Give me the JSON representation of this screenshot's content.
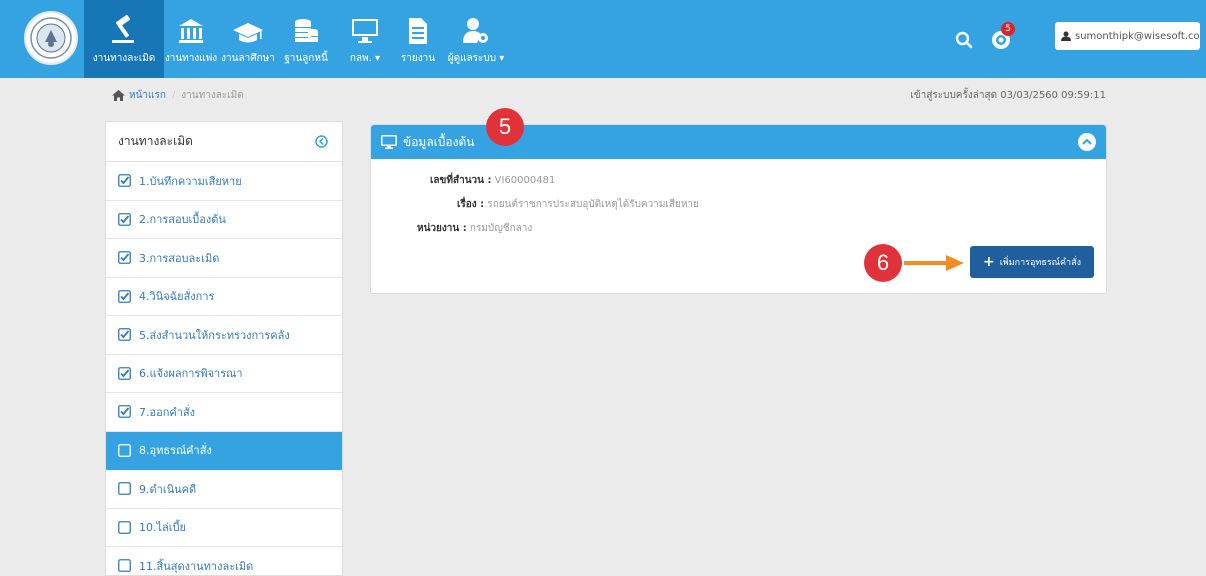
{
  "topnav": {
    "items": [
      {
        "label": "งานทางละเมิด",
        "icon": "gavel-icon",
        "active": true
      },
      {
        "label": "งานทางแพ่ง",
        "icon": "bank-icon",
        "active": false
      },
      {
        "label": "งานลาศึกษา",
        "icon": "graduation-cap-icon",
        "active": false
      },
      {
        "label": "ฐานลูกหนี้",
        "icon": "coins-icon",
        "active": false
      },
      {
        "label": "กลพ. ▾",
        "icon": "monitor-icon",
        "active": false
      },
      {
        "label": "รายงาน",
        "icon": "document-icon",
        "active": false
      },
      {
        "label": "ผู้ดูแลระบบ ▾",
        "icon": "user-gear-icon",
        "active": false
      }
    ],
    "notification_count": "5",
    "user_email": "sumonthipk@wisesoft.co.th"
  },
  "breadcrumb": {
    "home": "หน้าแรก",
    "separator": "/",
    "current": "งานทางละเมิด"
  },
  "last_login": "เข้าสู่ระบบครั้งล่าสุด 03/03/2560 09:59:11",
  "sidebar": {
    "title": "งานทางละเมิด",
    "items": [
      {
        "label": "1.บันทึกความเสียหาย",
        "checked": true
      },
      {
        "label": "2.การสอบเบื้องต้น",
        "checked": true
      },
      {
        "label": "3.การสอบละเมิด",
        "checked": true
      },
      {
        "label": "4.วินิจฉัยสั่งการ",
        "checked": true
      },
      {
        "label": "5.ส่งสำนวนให้กระทรวงการคลัง",
        "checked": true
      },
      {
        "label": "6.แจ้งผลการพิจารณา",
        "checked": true
      },
      {
        "label": "7.ออกคำสั่ง",
        "checked": true
      },
      {
        "label": "8.อุทธรณ์คำสั่ง",
        "checked": false,
        "active": true
      },
      {
        "label": "9.ดำเนินคดี",
        "checked": false
      },
      {
        "label": "10.ไล่เบี้ย",
        "checked": false
      },
      {
        "label": "11.สิ้นสุดงานทางละเมิด",
        "checked": false
      }
    ]
  },
  "panel": {
    "title": "ข้อมูลเบื้องต้น",
    "fields": {
      "case_no_label": "เลขที่สำนวน :",
      "case_no_value": "VI60000481",
      "subject_label": "เรื่อง :",
      "subject_value": "รถยนต์ราชการประสบอุบัติเหตุได้รับความเสียหาย",
      "agency_label": "หน่วยงาน :",
      "agency_value": "กรมบัญชีกลาง"
    },
    "add_button": "เพิ่มการอุทธรณ์คำสั่ง"
  },
  "annotations": {
    "marker_5": "5",
    "marker_6": "6"
  },
  "colors": {
    "nav_bg": "#35a3e2",
    "nav_active": "#1676b6",
    "button": "#1f5f9e",
    "marker": "#e0323a",
    "arrow": "#f28c1e"
  }
}
